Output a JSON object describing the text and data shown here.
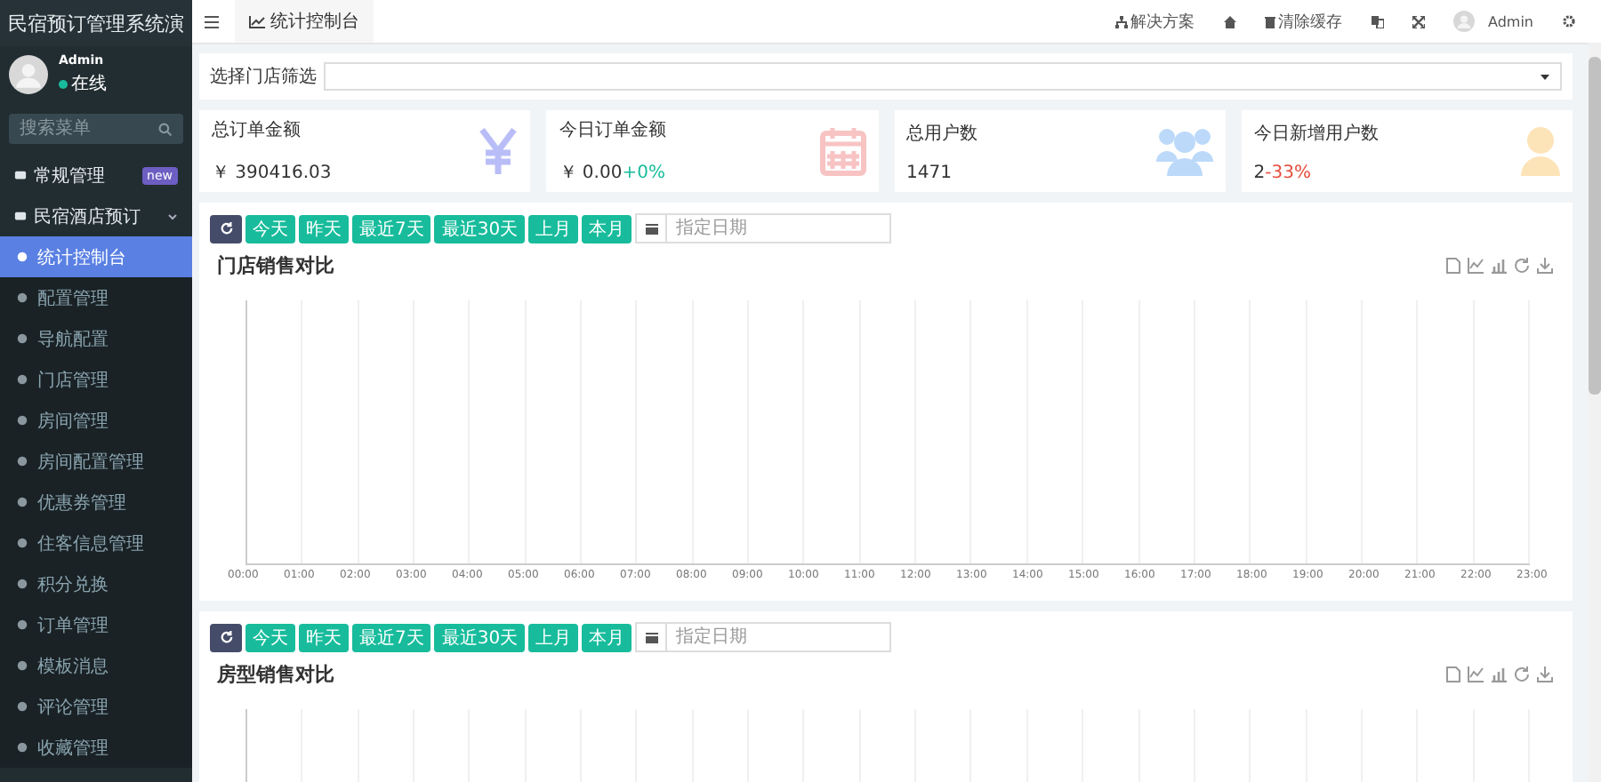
{
  "sidebar": {
    "title": "民宿预订管理系统演",
    "user": {
      "name": "Admin",
      "status": "在线",
      "online": true
    },
    "search": {
      "placeholder": "搜索菜单"
    },
    "groups": [
      {
        "label": "常规管理",
        "badge": "new"
      },
      {
        "label": "民宿酒店预订",
        "expanded": true,
        "children": [
          {
            "label": "统计控制台",
            "selected": true
          },
          {
            "label": "配置管理",
            "selected": false
          },
          {
            "label": "导航配置",
            "selected": false
          },
          {
            "label": "门店管理",
            "selected": false
          },
          {
            "label": "房间管理",
            "selected": false
          },
          {
            "label": "房间配置管理",
            "selected": false
          },
          {
            "label": "优惠券管理",
            "selected": false
          },
          {
            "label": "住客信息管理",
            "selected": false
          },
          {
            "label": "积分兑换",
            "selected": false
          },
          {
            "label": "订单管理",
            "selected": false
          },
          {
            "label": "模板消息",
            "selected": false
          },
          {
            "label": "评论管理",
            "selected": false
          },
          {
            "label": "收藏管理",
            "selected": false
          }
        ]
      }
    ]
  },
  "topbar": {
    "tab": "统计控制台",
    "actions": [
      "解决方案",
      "清除缓存"
    ],
    "user": "Admin"
  },
  "filter": {
    "label": "选择门店筛选"
  },
  "stats": [
    {
      "label": "总订单金额",
      "value": "￥ 390416.03",
      "kind": "yen",
      "color": "#b9bdf7"
    },
    {
      "label": "今日订单金额",
      "value": "￥ 0.00",
      "change": "+0%",
      "rising": true,
      "kind": "calendar",
      "color": "#f8c3c3"
    },
    {
      "label": "总用户数",
      "value": "1471",
      "kind": "users",
      "color": "#bcd9fa"
    },
    {
      "label": "今日新增用户数",
      "value": "2",
      "change": "-33%",
      "rising": false,
      "kind": "user",
      "color": "#fde3b8"
    }
  ],
  "panels": [
    {
      "title": "门店销售对比",
      "buttons": [
        "今天",
        "昨天",
        "最近7天",
        "最近30天",
        "上月",
        "本月"
      ],
      "date_placeholder": "指定日期",
      "x_labels": [
        "00:00",
        "01:00",
        "02:00",
        "03:00",
        "04:00",
        "05:00",
        "06:00",
        "07:00",
        "08:00",
        "09:00",
        "10:00",
        "11:00",
        "12:00",
        "13:00",
        "14:00",
        "15:00",
        "16:00",
        "17:00",
        "18:00",
        "19:00",
        "20:00",
        "21:00",
        "22:00",
        "23:00"
      ]
    },
    {
      "title": "房型销售对比",
      "buttons": [
        "今天",
        "昨天",
        "最近7天",
        "最近30天",
        "上月",
        "本月"
      ],
      "date_placeholder": "指定日期"
    }
  ]
}
